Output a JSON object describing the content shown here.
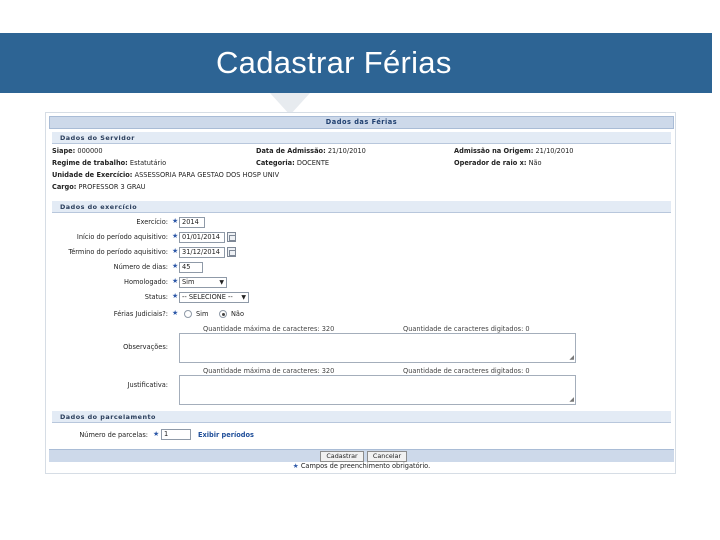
{
  "slide": {
    "title": "Cadastrar Férias"
  },
  "form": {
    "caption": "Dados das Férias",
    "servidor": {
      "section_title": "Dados do Servidor",
      "siape_label": "Siape:",
      "siape_value": "000000",
      "data_admissao_label": "Data de Admissão:",
      "data_admissao_value": "21/10/2010",
      "admissao_origem_label": "Admissão na Origem:",
      "admissao_origem_value": "21/10/2010",
      "regime_label": "Regime de trabalho:",
      "regime_value": "Estatutário",
      "categoria_label": "Categoria:",
      "categoria_value": "DOCENTE",
      "operador_label": "Operador de raio x:",
      "operador_value": "Não",
      "unidade_label": "Unidade de Exercício:",
      "unidade_value": "ASSESSORIA PARA GESTAO DOS HOSP UNIV",
      "cargo_label": "Cargo:",
      "cargo_value": "PROFESSOR 3 GRAU"
    },
    "exercicio": {
      "section_title": "Dados do exercício",
      "exercicio_label": "Exercício:",
      "exercicio_value": "2014",
      "inicio_label": "Início do período aquisitivo:",
      "inicio_value": "01/01/2014",
      "termino_label": "Término do período aquisitivo:",
      "termino_value": "31/12/2014",
      "numero_dias_label": "Número de dias:",
      "numero_dias_value": "45",
      "homologado_label": "Homologado:",
      "homologado_value": "Sim",
      "status_label": "Status:",
      "status_value": "-- SELECIONE --",
      "ferias_judiciais_label": "Férias Judiciais?:",
      "radio_sim": "Sim",
      "radio_nao": "Não",
      "radio_selected": "Não",
      "obs_max_text": "Quantidade máxima de caracteres: 320",
      "obs_typed_text": "Quantidade de caracteres digitados: 0",
      "observacoes_label": "Observações:",
      "just_max_text": "Quantidade máxima de caracteres: 320",
      "just_typed_text": "Quantidade de caracteres digitados: 0",
      "justificativa_label": "Justificativa:"
    },
    "parcelamento": {
      "section_title": "Dados do parcelamento",
      "parcelas_label": "Número de parcelas:",
      "parcelas_value": "1",
      "exibir_link": "Exibir períodos"
    },
    "buttons": {
      "cadastrar": "Cadastrar",
      "cancelar": "Cancelar"
    },
    "required_note": "Campos de preenchimento obrigatório."
  },
  "colors": {
    "title_bar": "#2d6494",
    "caption_bg": "#cdd9ea",
    "section_bg": "#e3ebf5",
    "required_star": "#2d58a8"
  },
  "icons": [
    "calendar-icon",
    "required-star-icon",
    "dropdown-arrow-icon",
    "resize-handle-icon"
  ]
}
